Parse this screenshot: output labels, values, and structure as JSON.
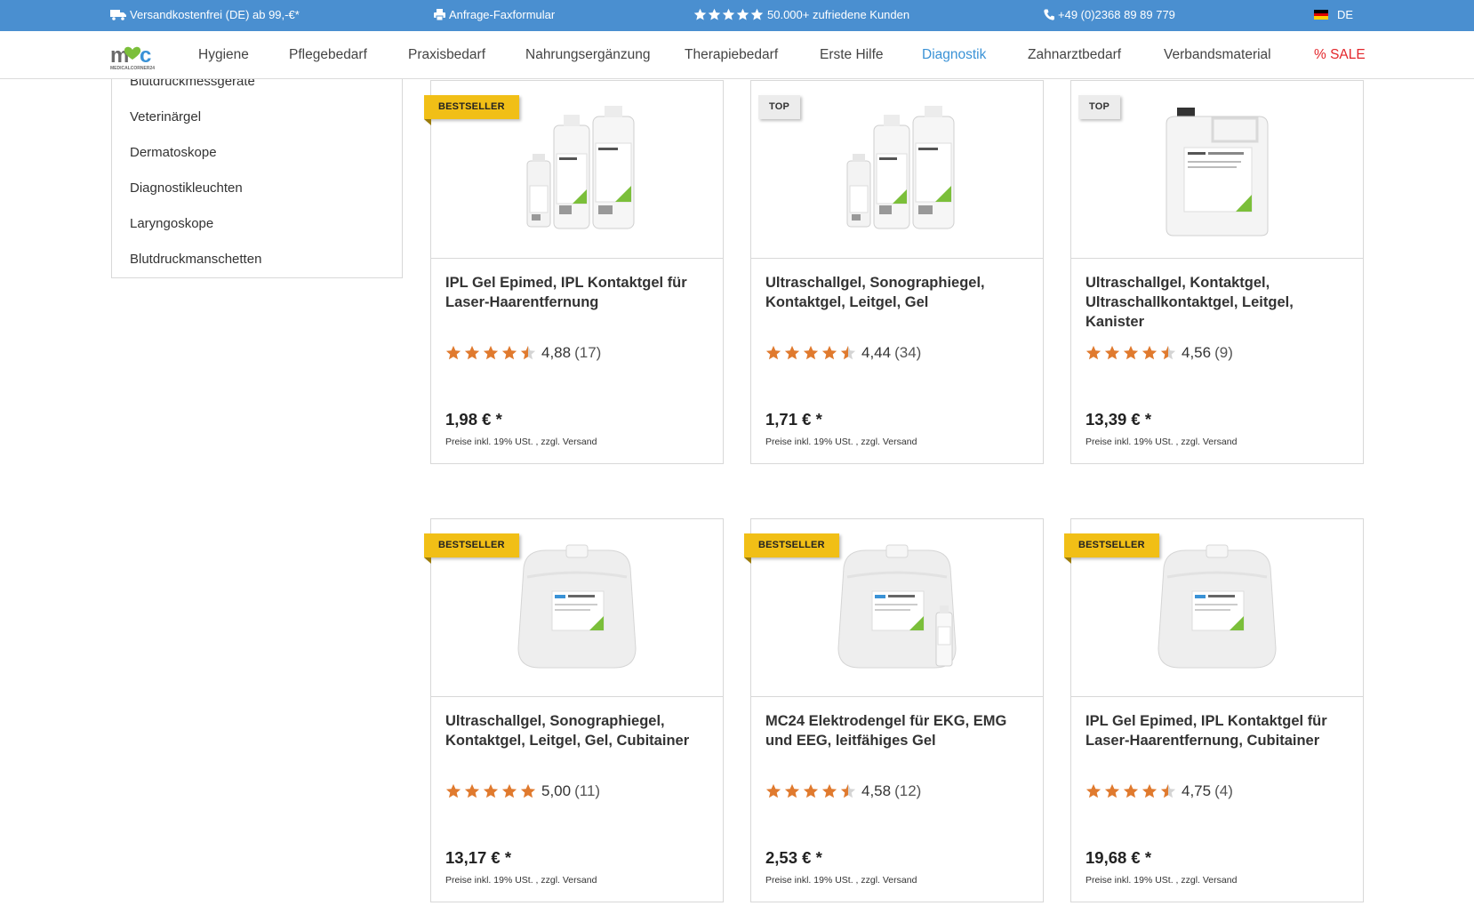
{
  "topbar": {
    "shipping": "Versandkostenfrei (DE) ab 99,-€*",
    "fax": "Anfrage-Faxformular",
    "customers": "50.000+ zufriedene Kunden",
    "phone": "+49 (0)2368 89 89 779",
    "language": "DE",
    "icons": [
      "truck-icon",
      "printer-icon",
      "star-icon",
      "phone-icon",
      "german-flag-icon"
    ]
  },
  "nav": {
    "logo_text": "MEDICALCORNER24",
    "items": [
      "Hygiene",
      "Pflegebedarf",
      "Praxisbedarf",
      "Nahrungsergänzung",
      "Therapiebedarf",
      "Erste Hilfe",
      "Diagnostik",
      "Zahnarztbedarf",
      "Verbandsmaterial",
      "% SALE"
    ],
    "active": "Diagnostik",
    "colors": {
      "active": "#3a92d6",
      "sale": "#e3262b"
    }
  },
  "sidebar": {
    "items": [
      "Blutdruckmessgeräte",
      "Veterinärgel",
      "Dermatoskope",
      "Diagnostikleuchten",
      "Laryngoskope",
      "Blutdruckmanschetten"
    ]
  },
  "products": [
    {
      "badge": "BESTSELLER",
      "title": "IPL Gel Epimed, IPL Kontaktgel für Laser-Haarentfernung",
      "rating": "4,88",
      "count": "(17)",
      "stars": 4.88,
      "price": "1,98 € *",
      "tax": "Preise inkl. 19% USt. , zzgl. Versand",
      "image": "bottles"
    },
    {
      "badge": "TOP",
      "title": "Ultraschallgel, Sonographiegel, Kontaktgel, Leitgel, Gel",
      "rating": "4,44",
      "count": "(34)",
      "stars": 4.44,
      "price": "1,71 € *",
      "tax": "Preise inkl. 19% USt. , zzgl. Versand",
      "image": "bottles"
    },
    {
      "badge": "TOP",
      "title": "Ultraschallgel, Kontaktgel, Ultraschallkontaktgel, Leitgel, Kanister",
      "rating": "4,56",
      "count": "(9)",
      "stars": 4.56,
      "price": "13,39 € *",
      "tax": "Preise inkl. 19% USt. , zzgl. Versand",
      "image": "canister"
    },
    {
      "badge": "BESTSELLER",
      "title": "Ultraschallgel, Sonographiegel, Kontaktgel, Leitgel, Gel, Cubitainer",
      "rating": "5,00",
      "count": "(11)",
      "stars": 5.0,
      "price": "13,17 € *",
      "tax": "Preise inkl. 19% USt. , zzgl. Versand",
      "image": "cubitainer"
    },
    {
      "badge": "BESTSELLER",
      "title": "MC24 Elektrodengel für EKG, EMG und EEG, leitfähiges Gel",
      "rating": "4,58",
      "count": "(12)",
      "stars": 4.58,
      "price": "2,53 € *",
      "tax": "Preise inkl. 19% USt. , zzgl. Versand",
      "image": "cubitainer-bottle"
    },
    {
      "badge": "BESTSELLER",
      "title": "IPL Gel Epimed, IPL Kontaktgel für Laser-Haarentfernung, Cubitainer",
      "rating": "4,75",
      "count": "(4)",
      "stars": 4.75,
      "price": "19,68 € *",
      "tax": "Preise inkl. 19% USt. , zzgl. Versand",
      "image": "cubitainer"
    }
  ],
  "colors": {
    "topbar": "#4a8fd0",
    "star": "#e07a2e",
    "bestseller": "#f1bf16",
    "top": "#ececec"
  }
}
